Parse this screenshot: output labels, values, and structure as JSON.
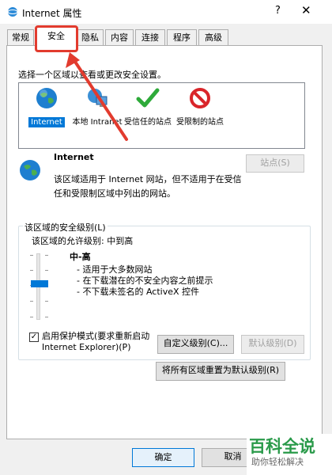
{
  "window": {
    "title": "Internet 属性",
    "help_label": "?",
    "close_label": "✕",
    "icon": "ie-globe-icon"
  },
  "tabs": [
    {
      "label": "常规"
    },
    {
      "label": "安全"
    },
    {
      "label": "隐私"
    },
    {
      "label": "内容"
    },
    {
      "label": "连接"
    },
    {
      "label": "程序"
    },
    {
      "label": "高级"
    }
  ],
  "security": {
    "zone_prompt": "选择一个区域以查看或更改安全设置。",
    "zones": [
      {
        "label": "Internet",
        "icon": "globe-icon"
      },
      {
        "label": "本地 Intranet",
        "icon": "intranet-icon"
      },
      {
        "label": "受信任的站点",
        "icon": "checkmark-icon"
      },
      {
        "label": "受限制的站点",
        "icon": "blocked-icon"
      }
    ],
    "selected_zone_name": "Internet",
    "zone_description": "该区域适用于 Internet 网站，但不适用于在受信任和受限制区域中列出的网站。",
    "sites_button": "站点(S)",
    "level_group_title": "该区域的安全级别(L)",
    "allowed_levels": "该区域的允许级别: 中到高",
    "level_name": "中-高",
    "level_points": [
      "- 适用于大多数网站",
      "- 在下载潜在的不安全内容之前提示",
      "- 不下载未签名的 ActiveX 控件"
    ],
    "protected_mode_label": "启用保护模式(要求重新启动 Internet Explorer)(P)",
    "protected_mode_checked": true,
    "custom_level_button": "自定义级别(C)...",
    "default_level_button": "默认级别(D)",
    "reset_all_button": "将所有区域重置为默认级别(R)"
  },
  "footer": {
    "ok_button": "确定",
    "cancel_button": "取消"
  },
  "watermark": {
    "main": "百科全说",
    "sub": "助你轻松解决"
  },
  "colors": {
    "accent": "#0078d7",
    "highlight": "#e23b2e",
    "brand": "#2a9a4a"
  }
}
